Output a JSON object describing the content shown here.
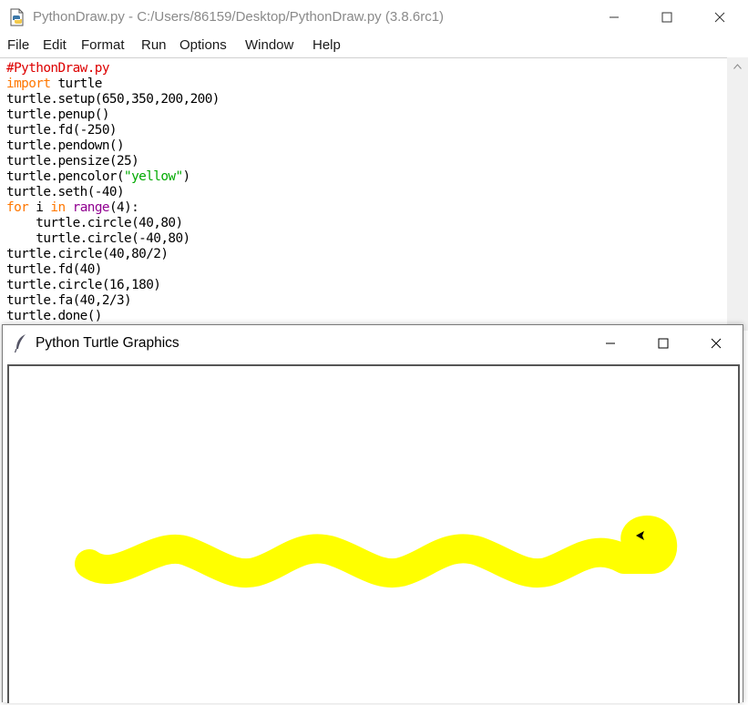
{
  "idle": {
    "window_title": "PythonDraw.py - C:/Users/86159/Desktop/PythonDraw.py (3.8.6rc1)",
    "menu": [
      "File",
      "Edit",
      "Format",
      "Run",
      "Options",
      "Window",
      "Help"
    ],
    "code": [
      [
        {
          "t": "#PythonDraw.py",
          "k": "comment"
        }
      ],
      [
        {
          "t": "import",
          "k": "keyword"
        },
        {
          "t": " turtle",
          "k": "plain"
        }
      ],
      [
        {
          "t": "turtle.setup(650,350,200,200)",
          "k": "plain"
        }
      ],
      [
        {
          "t": "turtle.penup()",
          "k": "plain"
        }
      ],
      [
        {
          "t": "turtle.fd(-250)",
          "k": "plain"
        }
      ],
      [
        {
          "t": "turtle.pendown()",
          "k": "plain"
        }
      ],
      [
        {
          "t": "turtle.pensize(25)",
          "k": "plain"
        }
      ],
      [
        {
          "t": "turtle.pencolor(",
          "k": "plain"
        },
        {
          "t": "\"yellow\"",
          "k": "string"
        },
        {
          "t": ")",
          "k": "plain"
        }
      ],
      [
        {
          "t": "turtle.seth(-40)",
          "k": "plain"
        }
      ],
      [
        {
          "t": "for",
          "k": "keyword"
        },
        {
          "t": " i ",
          "k": "plain"
        },
        {
          "t": "in",
          "k": "keyword"
        },
        {
          "t": " ",
          "k": "plain"
        },
        {
          "t": "range",
          "k": "builtin"
        },
        {
          "t": "(4):",
          "k": "plain"
        }
      ],
      [
        {
          "t": "    turtle.circle(40,80)",
          "k": "plain"
        }
      ],
      [
        {
          "t": "    turtle.circle(-40,80)",
          "k": "plain"
        }
      ],
      [
        {
          "t": "turtle.circle(40,80/2)",
          "k": "plain"
        }
      ],
      [
        {
          "t": "turtle.fd(40)",
          "k": "plain"
        }
      ],
      [
        {
          "t": "turtle.circle(16,180)",
          "k": "plain"
        }
      ],
      [
        {
          "t": "turtle.fa(40,2/3)",
          "k": "plain"
        }
      ],
      [
        {
          "t": "turtle.done()",
          "k": "plain"
        }
      ]
    ]
  },
  "turtle_window": {
    "title": "Python Turtle Graphics",
    "pen_color": "#ffff00",
    "cursor_color": "#000000"
  },
  "icons": {
    "idle_app": "python-file-icon",
    "turtle_app": "feather-icon",
    "minimize": "minimize-icon",
    "maximize": "maximize-icon",
    "close": "close-icon",
    "scroll_up": "arrow-up-icon"
  },
  "colors": {
    "comment": "#dd0000",
    "keyword": "#ff7700",
    "builtin": "#900090",
    "string": "#00aa00"
  }
}
